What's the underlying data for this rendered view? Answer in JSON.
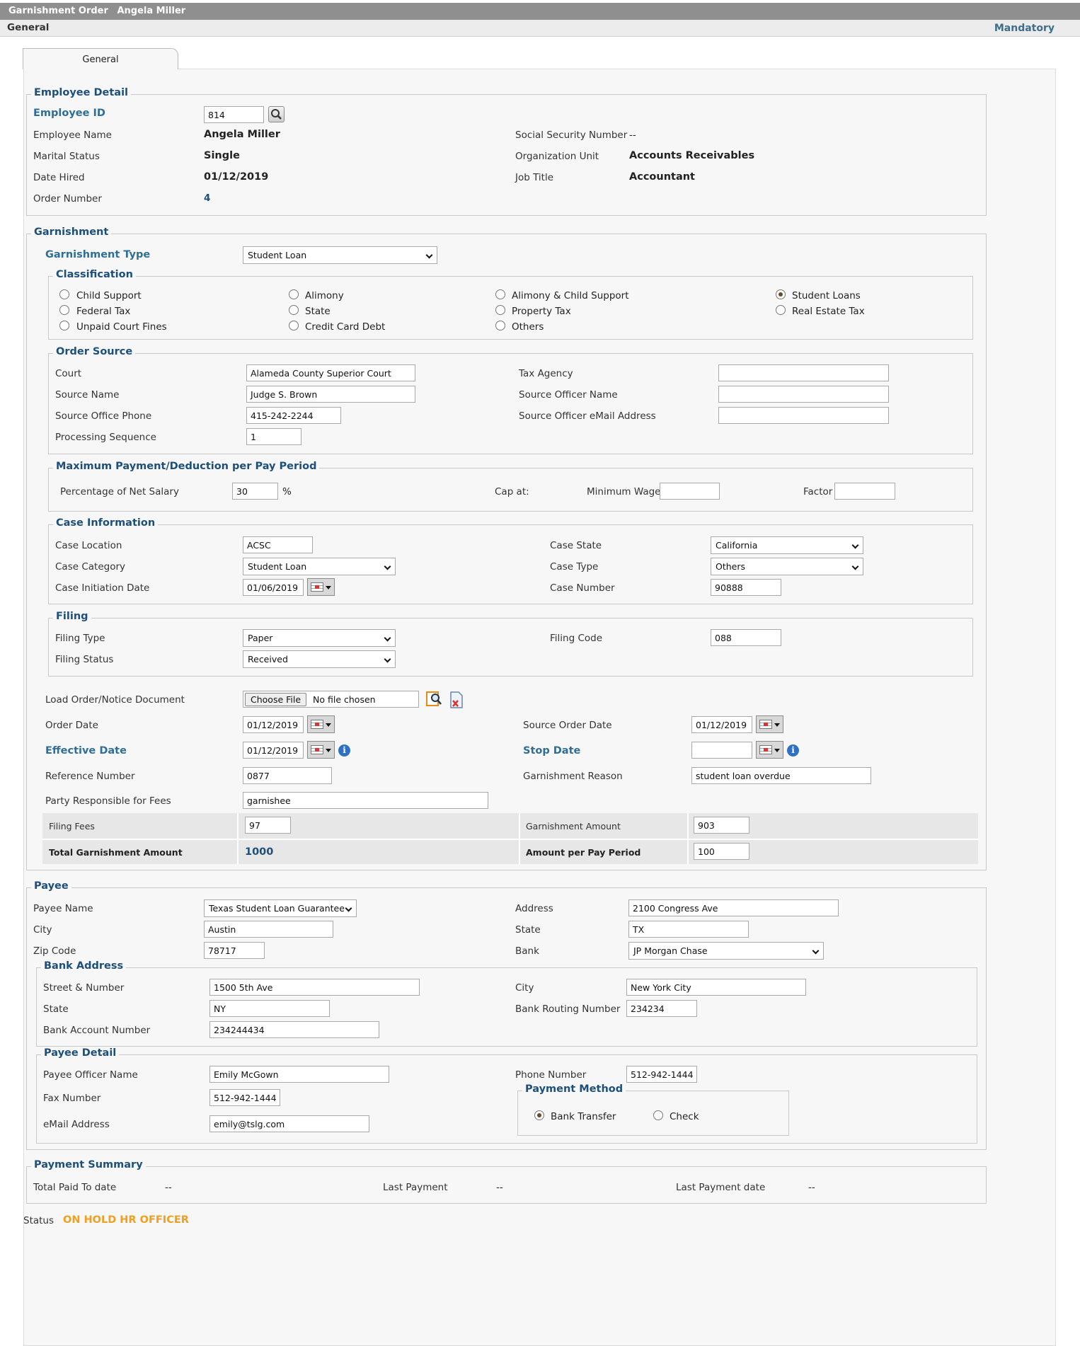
{
  "window": {
    "title": "Garnishment Order",
    "employee": "Angela Miller"
  },
  "menubar": {
    "section": "General",
    "mandatory": "Mandatory"
  },
  "tabs": {
    "general": "General"
  },
  "employee_detail": {
    "legend": "Employee Detail",
    "employee_id_label": "Employee ID",
    "employee_id": "814",
    "name_label": "Employee Name",
    "name": "Angela Miller",
    "marital_label": "Marital Status",
    "marital": "Single",
    "hired_label": "Date Hired",
    "hired": "01/12/2019",
    "order_label": "Order Number",
    "order": "4",
    "ssn_label": "Social Security Number",
    "ssn": "--",
    "org_label": "Organization Unit",
    "org": "Accounts Receivables",
    "job_label": "Job Title",
    "job": "Accountant"
  },
  "garnishment": {
    "legend": "Garnishment",
    "type_label": "Garnishment Type",
    "type": "Student Loan",
    "classification": {
      "legend": "Classification",
      "options": [
        "Child Support",
        "Federal Tax",
        "Unpaid Court Fines",
        "Alimony",
        "State",
        "Credit Card Debt",
        "Alimony & Child Support",
        "Property Tax",
        "Others",
        "Student Loans",
        "Real Estate Tax"
      ],
      "selected": "Student Loans"
    },
    "order_source": {
      "legend": "Order Source",
      "court_label": "Court",
      "court": "Alameda County Superior Court",
      "source_name_label": "Source Name",
      "source_name": "Judge S. Brown",
      "phone_label": "Source Office Phone",
      "phone": "415-242-2244",
      "seq_label": "Processing Sequence",
      "seq": "1",
      "tax_agency_label": "Tax Agency",
      "tax_agency": "",
      "officer_name_label": "Source Officer Name",
      "officer_name": "",
      "officer_email_label": "Source Officer eMail Address",
      "officer_email": ""
    },
    "max_payment": {
      "legend": "Maximum Payment/Deduction per Pay Period",
      "pct_label": "Percentage of Net Salary",
      "pct": "30",
      "pct_unit": "%",
      "cap_label": "Cap at:",
      "min_wage_label": "Minimum Wage",
      "min_wage": "",
      "factor_label": "Factor",
      "factor": ""
    },
    "case_info": {
      "legend": "Case Information",
      "location_label": "Case Location",
      "location": "ACSC",
      "category_label": "Case Category",
      "category": "Student Loan",
      "init_date_label": "Case Initiation Date",
      "init_date": "01/06/2019",
      "state_label": "Case State",
      "state": "California",
      "type_label": "Case Type",
      "type": "Others",
      "number_label": "Case Number",
      "number": "90888"
    },
    "filing": {
      "legend": "Filing",
      "type_label": "Filing Type",
      "type": "Paper",
      "status_label": "Filing Status",
      "status": "Received",
      "code_label": "Filing Code",
      "code": "088"
    },
    "load_doc_label": "Load Order/Notice Document",
    "choose_file": "Choose File",
    "no_file": "No file chosen",
    "order_date_label": "Order Date",
    "order_date": "01/12/2019",
    "source_order_date_label": "Source Order Date",
    "source_order_date": "01/12/2019",
    "effective_label": "Effective Date",
    "effective": "01/12/2019",
    "stop_label": "Stop Date",
    "stop": "",
    "ref_label": "Reference Number",
    "ref": "0877",
    "reason_label": "Garnishment Reason",
    "reason": "student loan overdue",
    "party_label": "Party Responsible for Fees",
    "party": "garnishee",
    "filing_fees_label": "Filing Fees",
    "filing_fees": "97",
    "garn_amount_label": "Garnishment Amount",
    "garn_amount": "903",
    "total_label": "Total Garnishment Amount",
    "total": "1000",
    "per_period_label": "Amount per Pay Period",
    "per_period": "100"
  },
  "payee": {
    "legend": "Payee",
    "name_label": "Payee Name",
    "name": "Texas Student Loan Guarantee",
    "city_label": "City",
    "city": "Austin",
    "zip_label": "Zip Code",
    "zip": "78717",
    "address_label": "Address",
    "address": "2100 Congress Ave",
    "state_label": "State",
    "state": "TX",
    "bank_label": "Bank",
    "bank": "JP Morgan Chase",
    "bank_address": {
      "legend": "Bank Address",
      "street_label": "Street & Number",
      "street": "1500 5th Ave",
      "state_label": "State",
      "state": "NY",
      "account_label": "Bank Account Number",
      "account": "234244434",
      "city_label": "City",
      "city": "New York City",
      "routing_label": "Bank Routing Number",
      "routing": "234234"
    },
    "detail": {
      "legend": "Payee Detail",
      "officer_label": "Payee Officer Name",
      "officer": "Emily McGown",
      "fax_label": "Fax Number",
      "fax": "512-942-1444",
      "email_label": "eMail Address",
      "email": "emily@tslg.com",
      "phone_label": "Phone Number",
      "phone": "512-942-1444",
      "method_legend": "Payment Method",
      "bank_transfer": "Bank Transfer",
      "check": "Check",
      "method_selected": "Bank Transfer"
    }
  },
  "payment_summary": {
    "legend": "Payment Summary",
    "total_paid_label": "Total Paid To date",
    "total_paid": "--",
    "last_payment_label": "Last Payment",
    "last_payment": "--",
    "last_date_label": "Last Payment date",
    "last_date": "--"
  },
  "status": {
    "label": "Status",
    "value": "ON HOLD HR OFFICER",
    "color": "#f0a020"
  },
  "colors": {
    "accent": "#1d4f7c",
    "label_blue": "#2e6e99",
    "titlebar": "#8f8f8f"
  }
}
